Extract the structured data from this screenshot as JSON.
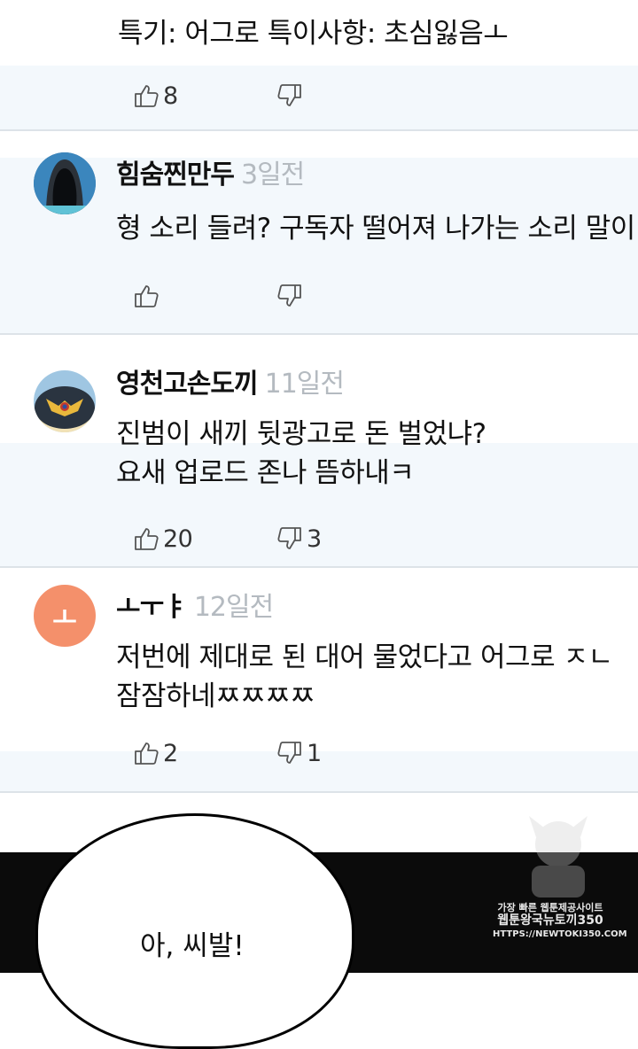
{
  "top_partial": {
    "cut_text": "",
    "line": "특기: 어그로 특이사항: 초심잃음ㅗ",
    "likes": "8",
    "dislikes": ""
  },
  "comments": [
    {
      "username": "힘숨찐만두",
      "time": "3일전",
      "lines": [
        "형 소리 들려? 구독자 떨어져 나가는 소리 말이"
      ],
      "likes": "",
      "dislikes": "",
      "avatar": "hooded-figure"
    },
    {
      "username": "영천고손도끼",
      "time": "11일전",
      "lines": [
        "진범이 새끼 뒷광고로 돈 벌었냐?",
        "요새 업로드 존나 뜸하내ㅋ"
      ],
      "likes": "20",
      "dislikes": "3",
      "avatar": "police-emblem"
    },
    {
      "username": "ㅗㅜㅑ",
      "time": "12일전",
      "lines": [
        "저번에 제대로 된 대어 물었다고 어그로 ㅈㄴ",
        "잠잠하네ㅉㅉㅉㅉ"
      ],
      "likes": "2",
      "dislikes": "1",
      "avatar": "ㅗ",
      "avatar_color": "#f4906b"
    }
  ],
  "comic": {
    "speech": "아, 씨발!",
    "watermark": [
      "가장 빠른 웹툰제공사이트",
      "웹툰왕국뉴토끼350",
      "HTTPS://NEWTOKI350.COM"
    ]
  },
  "colors": {
    "band": "#f3f8fc",
    "separator": "#dde3e8",
    "timestamp": "#b4bac0",
    "icon": "#555555"
  }
}
